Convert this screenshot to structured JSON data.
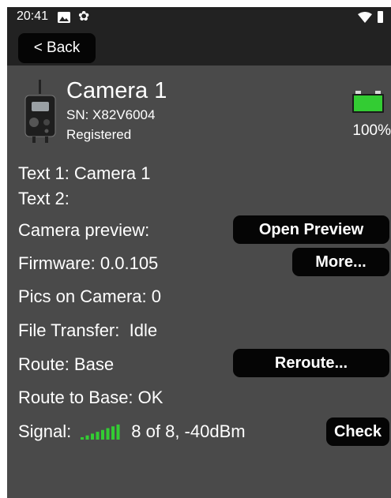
{
  "status_bar": {
    "time": "20:41",
    "icons": [
      "image-icon",
      "gear-icon",
      "wifi-icon",
      "battery-icon"
    ]
  },
  "nav": {
    "back_label": "< Back"
  },
  "camera": {
    "name": "Camera 1",
    "serial": "SN: X82V6004",
    "state": "Registered",
    "battery_percent": "100%",
    "battery_color": "#33cc33"
  },
  "details": {
    "text1": "Text 1: Camera 1",
    "text2": "Text 2:",
    "preview_label": "Camera preview:",
    "firmware": "Firmware: 0.0.105",
    "pics": "Pics on Camera: 0",
    "file_transfer_label": "File Transfer:",
    "file_transfer_value": "Idle",
    "route": "Route: Base",
    "route_to_base": "Route to Base: OK",
    "signal_label": "Signal:",
    "signal_text": "8 of 8, -40dBm",
    "signal_level": 8,
    "signal_max": 8,
    "signal_color": "#33cc33"
  },
  "buttons": {
    "open_preview": "Open Preview",
    "more": "More...",
    "reroute": "Reroute...",
    "check": "Check"
  }
}
